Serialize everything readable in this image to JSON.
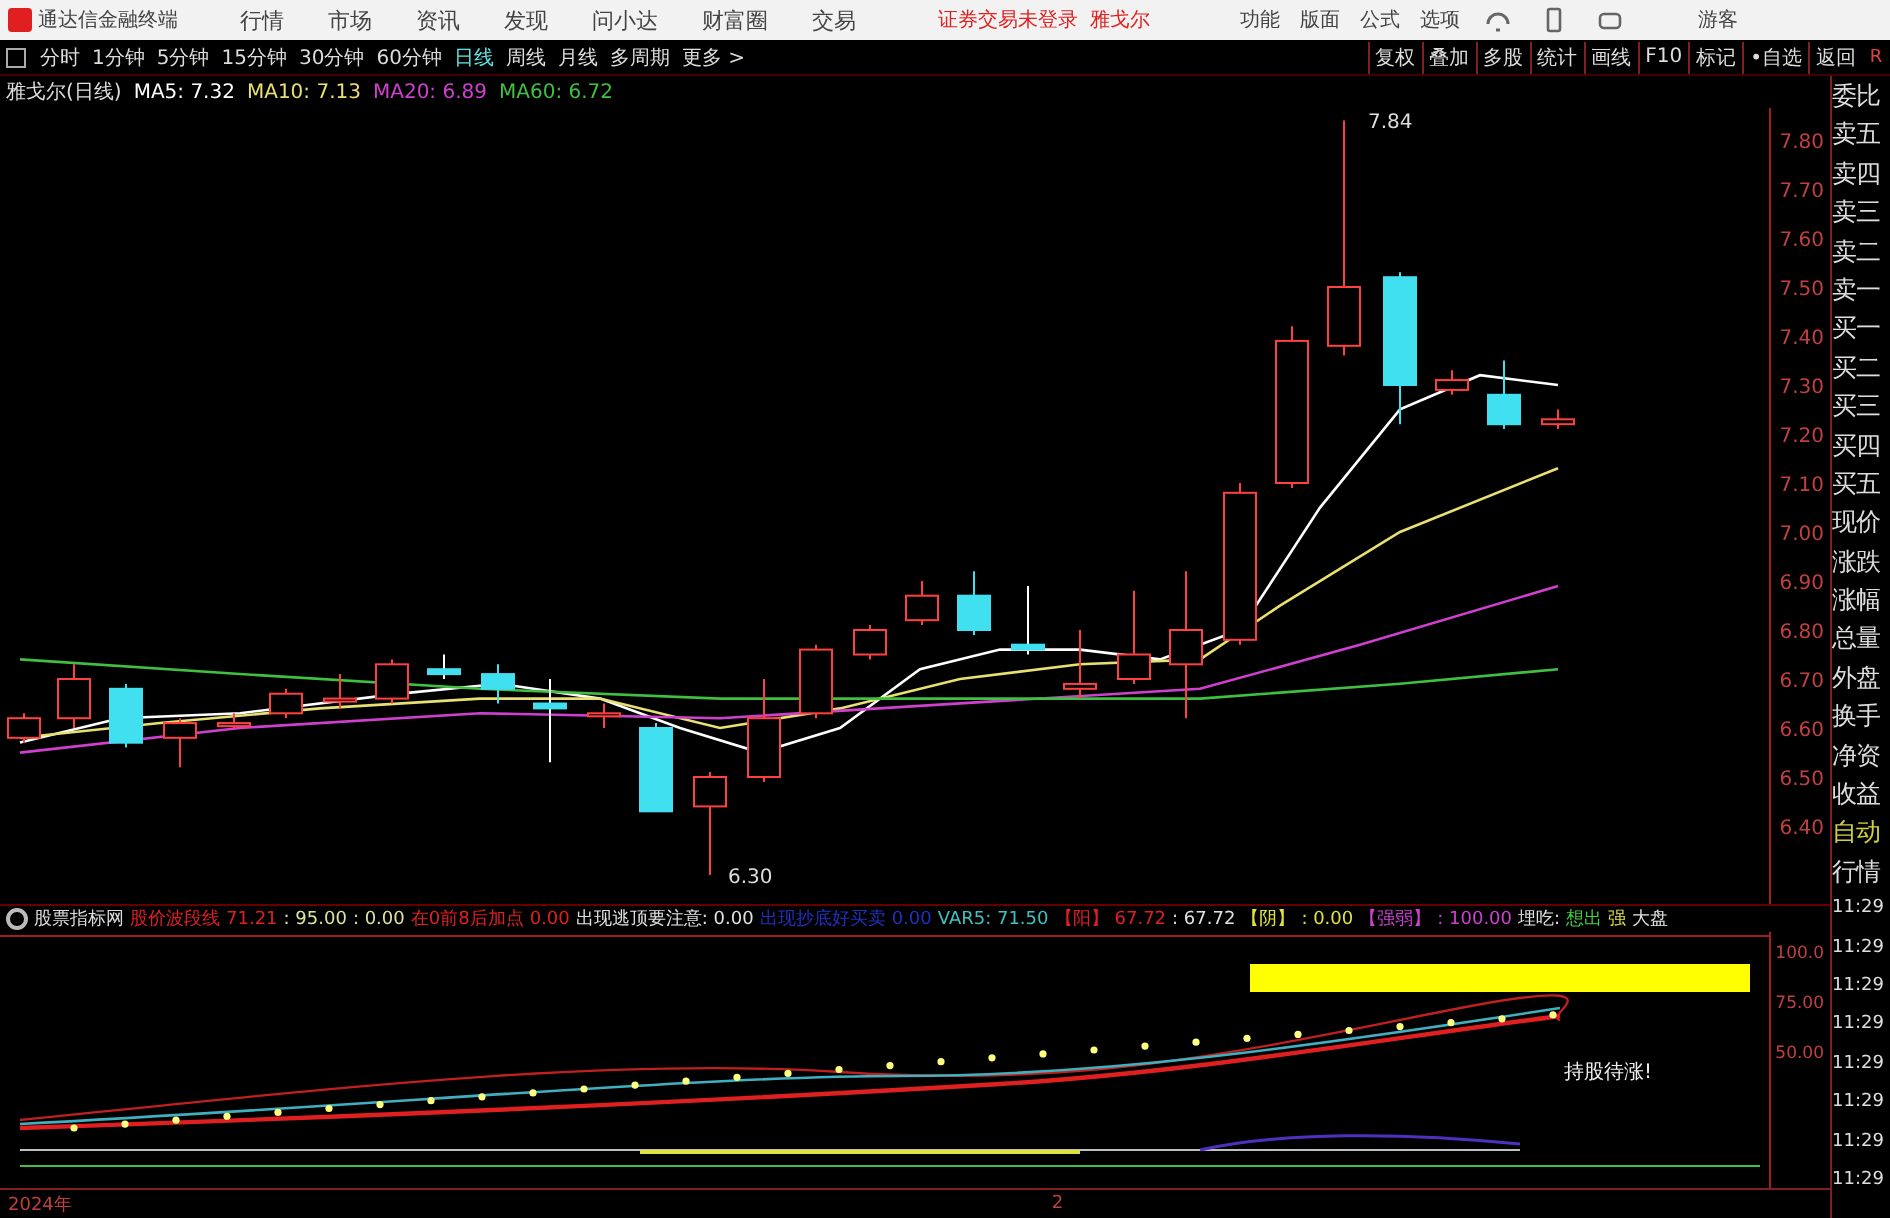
{
  "menu_bar": {
    "app_title": "通达信金融终端",
    "menus": [
      "行情",
      "市场",
      "资讯",
      "发现",
      "问小达",
      "财富圈",
      "交易"
    ],
    "notice": "证券交易未登录",
    "stock": "雅戈尔",
    "tools": [
      "功能",
      "版面",
      "公式",
      "选项"
    ],
    "user": "游客"
  },
  "toolbar": {
    "periods": [
      {
        "label": "分时",
        "selected": false
      },
      {
        "label": "1分钟",
        "selected": false
      },
      {
        "label": "5分钟",
        "selected": false
      },
      {
        "label": "15分钟",
        "selected": false
      },
      {
        "label": "30分钟",
        "selected": false
      },
      {
        "label": "60分钟",
        "selected": false
      },
      {
        "label": "日线",
        "selected": true
      },
      {
        "label": "周线",
        "selected": false
      },
      {
        "label": "月线",
        "selected": false
      },
      {
        "label": "多周期",
        "selected": false
      }
    ],
    "more": "更多 >",
    "actions": [
      "复权",
      "叠加",
      "多股",
      "统计",
      "画线",
      "F10",
      "标记",
      "•自选",
      "返回"
    ],
    "corner": "R"
  },
  "chart": {
    "title": "雅戈尔(日线)",
    "ma": [
      {
        "label": "MA5: 7.32",
        "color": "#ffffff"
      },
      {
        "label": "MA10: 7.13",
        "color": "#e8e070"
      },
      {
        "label": "MA20: 6.89",
        "color": "#d040d0"
      },
      {
        "label": "MA60: 6.72",
        "color": "#40c040"
      }
    ],
    "price_axis": [
      "7.80",
      "7.70",
      "7.60",
      "7.50",
      "7.40",
      "7.30",
      "7.20",
      "7.10",
      "7.00",
      "6.90",
      "6.80",
      "6.70",
      "6.60",
      "6.50",
      "6.40"
    ],
    "high_label": "7.84",
    "low_label": "6.30"
  },
  "indicator": {
    "name": "股票指标网",
    "items": [
      {
        "text": "股价波段线",
        "color": "#e02020"
      },
      {
        "text": "71.21",
        "color": "#e02020"
      },
      {
        "text": ": 95.00",
        "color": "#e0e0a0"
      },
      {
        "text": ": 0.00",
        "color": "#e0e0a0"
      },
      {
        "text": "在0前8后加点",
        "color": "#e02020"
      },
      {
        "text": "0.00",
        "color": "#e02020"
      },
      {
        "text": "出现逃顶要注意: 0.00",
        "color": "#e0e0e0"
      },
      {
        "text": "出现抄底好买卖",
        "color": "#2030c0"
      },
      {
        "text": "0.00",
        "color": "#2030c0"
      },
      {
        "text": "VAR5: 71.50",
        "color": "#40c0c0"
      },
      {
        "text": "【阳】",
        "color": "#e02020"
      },
      {
        "text": "67.72",
        "color": "#e02020"
      },
      {
        "text": ": 67.72",
        "color": "#e0e0e0"
      },
      {
        "text": "【阴】",
        "color": "#e0e040"
      },
      {
        "text": ": 0.00",
        "color": "#e0e040"
      },
      {
        "text": "【强弱】",
        "color": "#d040d0"
      },
      {
        "text": ": 100.00",
        "color": "#d040d0"
      },
      {
        "text": "埋吃:",
        "color": "#e0e0e0"
      },
      {
        "text": "想出",
        "color": "#40d040"
      },
      {
        "text": "强",
        "color": "#e0e040"
      },
      {
        "text": "大盘",
        "color": "#e0e0e0"
      }
    ],
    "axis": [
      "100.0",
      "75.00",
      "50.00"
    ],
    "signal": "持股待涨!"
  },
  "date_axis": [
    "2024年",
    "2"
  ],
  "quote_panel": {
    "labels": [
      "委比",
      "卖五",
      "卖四",
      "卖三",
      "卖二",
      "卖一",
      "买一",
      "买二",
      "买三",
      "买四",
      "买五",
      "现价",
      "涨跌",
      "涨幅",
      "总量",
      "外盘",
      "换手",
      "净资",
      "收益",
      "自动",
      "行情"
    ],
    "times": [
      "11:29",
      "11:29",
      "11:29",
      "11:29",
      "11:29",
      "11:29",
      "11:29",
      "11:29"
    ]
  }
}
